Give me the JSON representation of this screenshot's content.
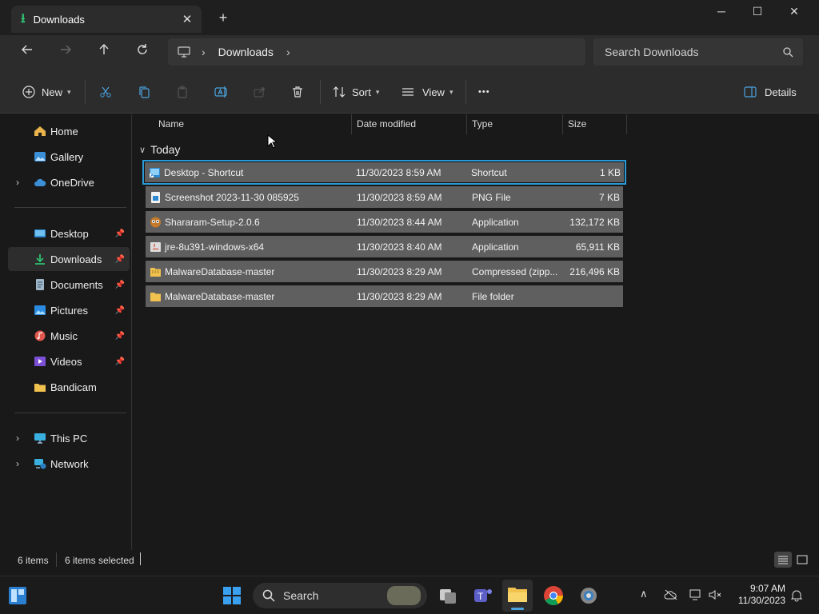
{
  "window": {
    "tab_title": "Downloads",
    "tab_close": "✕",
    "new_tab": "+",
    "minimize": "─",
    "maximize": "☐",
    "close": "✕"
  },
  "address": {
    "crumbs": [
      "Downloads"
    ],
    "search_placeholder": "Search Downloads"
  },
  "toolbar": {
    "new_label": "New",
    "sort_label": "Sort",
    "view_label": "View",
    "more_label": "•••",
    "details_label": "Details"
  },
  "sidebar": {
    "items": [
      {
        "label": "Home"
      },
      {
        "label": "Gallery"
      },
      {
        "label": "OneDrive"
      },
      {
        "label": "Desktop"
      },
      {
        "label": "Downloads"
      },
      {
        "label": "Documents"
      },
      {
        "label": "Pictures"
      },
      {
        "label": "Music"
      },
      {
        "label": "Videos"
      },
      {
        "label": "Bandicam"
      },
      {
        "label": "This PC"
      },
      {
        "label": "Network"
      }
    ]
  },
  "columns": {
    "name": "Name",
    "date": "Date modified",
    "type": "Type",
    "size": "Size"
  },
  "group": {
    "label": "Today"
  },
  "files": [
    {
      "name": "Desktop - Shortcut",
      "date": "11/30/2023 8:59 AM",
      "type": "Shortcut",
      "size": "1 KB"
    },
    {
      "name": "Screenshot 2023-11-30 085925",
      "date": "11/30/2023 8:59 AM",
      "type": "PNG File",
      "size": "7 KB"
    },
    {
      "name": "Shararam-Setup-2.0.6",
      "date": "11/30/2023 8:44 AM",
      "type": "Application",
      "size": "132,172 KB"
    },
    {
      "name": "jre-8u391-windows-x64",
      "date": "11/30/2023 8:40 AM",
      "type": "Application",
      "size": "65,911 KB"
    },
    {
      "name": "MalwareDatabase-master",
      "date": "11/30/2023 8:29 AM",
      "type": "Compressed (zipp...",
      "size": "216,496 KB"
    },
    {
      "name": "MalwareDatabase-master",
      "date": "11/30/2023 8:29 AM",
      "type": "File folder",
      "size": ""
    }
  ],
  "status": {
    "count": "6 items",
    "selected": "6 items selected"
  },
  "taskbar": {
    "search_label": "Search",
    "time": "9:07 AM",
    "date": "11/30/2023"
  },
  "colors": {
    "selection": "#5f5f5f",
    "focus_border": "#2b9bd8",
    "accent_green": "#2fbf71"
  }
}
